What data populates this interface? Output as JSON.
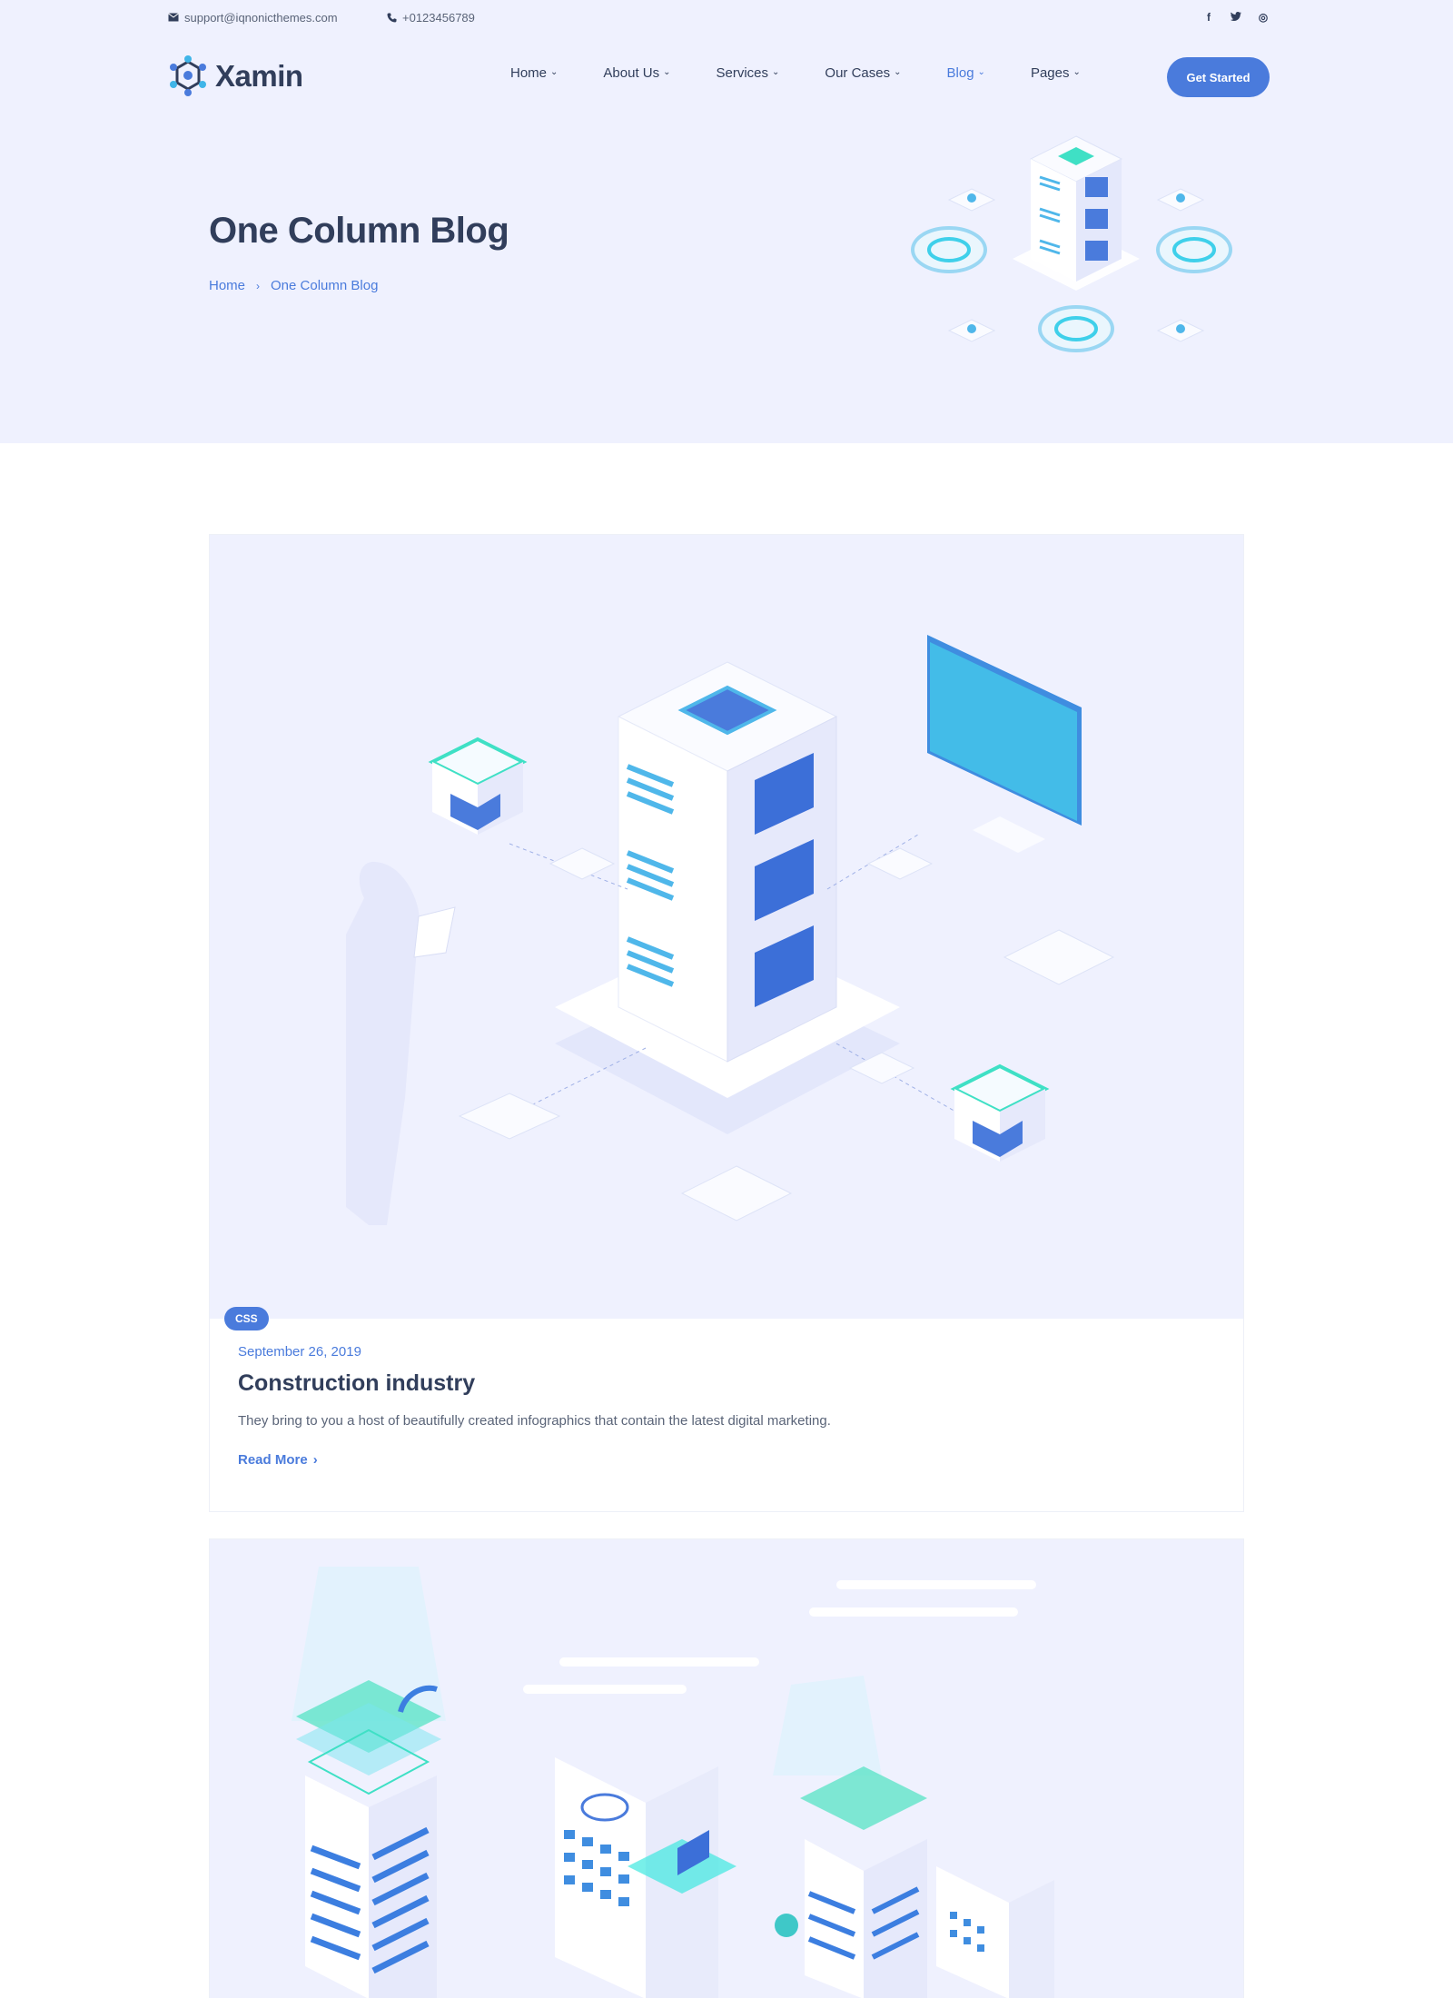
{
  "topbar": {
    "email": "support@iqnonicthemes.com",
    "phone": "+0123456789",
    "social": [
      "f",
      "t",
      "◎"
    ]
  },
  "header": {
    "logo_text": "Xamin",
    "nav": [
      {
        "label": "Home"
      },
      {
        "label": "About Us"
      },
      {
        "label": "Services"
      },
      {
        "label": "Our Cases"
      },
      {
        "label": "Blog"
      },
      {
        "label": "Pages"
      }
    ],
    "cta_label": "Get Started"
  },
  "hero": {
    "title": "One Column Blog",
    "breadcrumb_home": "Home",
    "breadcrumb_current": "One Column Blog"
  },
  "posts": [
    {
      "category": "CSS",
      "date": "September 26, 2019",
      "title": "Construction industry",
      "excerpt": "They bring to you a host of beautifully created infographics that contain the latest digital marketing.",
      "read_more": "Read More"
    }
  ],
  "colors": {
    "accent": "#4a7bdc",
    "hero_bg": "#eff1fe",
    "text_dark": "#313e5b",
    "teal": "#3fe0c5"
  },
  "icons": {
    "email": "envelope-icon",
    "phone": "phone-icon",
    "social": [
      "facebook-icon",
      "twitter-icon",
      "instagram-icon"
    ]
  }
}
